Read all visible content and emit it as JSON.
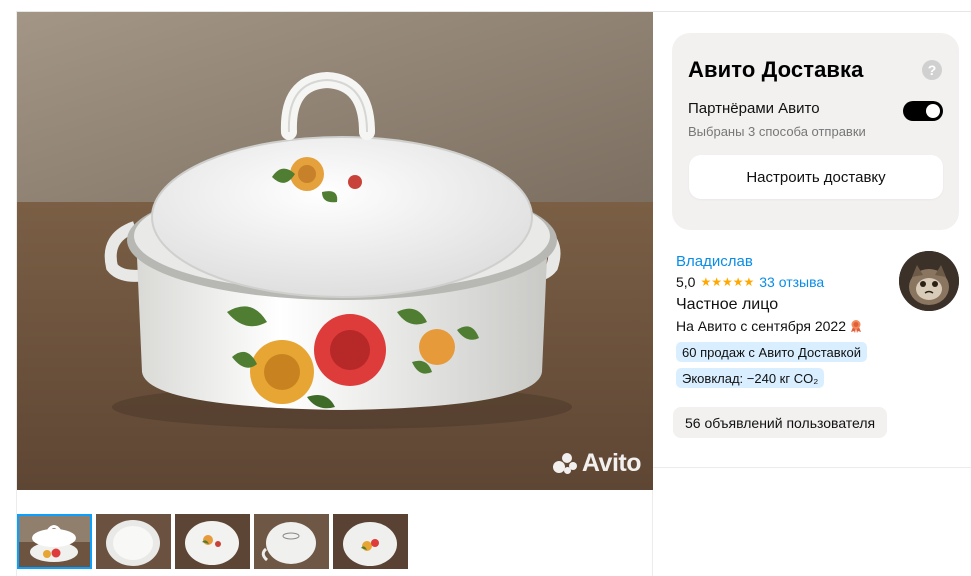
{
  "listing": {
    "watermark_text": "Avito",
    "thumbnail_count": 5,
    "thumbnails": [
      {
        "name": "photo-1",
        "active": true
      },
      {
        "name": "photo-2",
        "active": false
      },
      {
        "name": "photo-3",
        "active": false
      },
      {
        "name": "photo-4",
        "active": false
      },
      {
        "name": "photo-5",
        "active": false
      }
    ]
  },
  "delivery": {
    "title": "Авито Доставка",
    "help_icon": "?",
    "partners_label": "Партнёрами Авито",
    "partners_enabled": true,
    "partners_sub": "Выбраны 3 способа отправки",
    "setup_button": "Настроить доставку"
  },
  "seller": {
    "name": "Владислав",
    "rating": "5,0",
    "stars": "★★★★★",
    "reviews": "33 отзыва",
    "type": "Частное лицо",
    "since": "На Авито с сентября 2022",
    "badges": [
      "60 продаж с Авито Доставкой",
      "Эковклад: −240 кг CO₂"
    ],
    "listings_button": "56 объявлений пользователя"
  },
  "colors": {
    "link": "#0a8de8",
    "star": "#ffa800",
    "card_bg": "#f2f1f0",
    "badge_bg": "#d9efff",
    "active_thumb_outline": "#0aa0ff"
  }
}
